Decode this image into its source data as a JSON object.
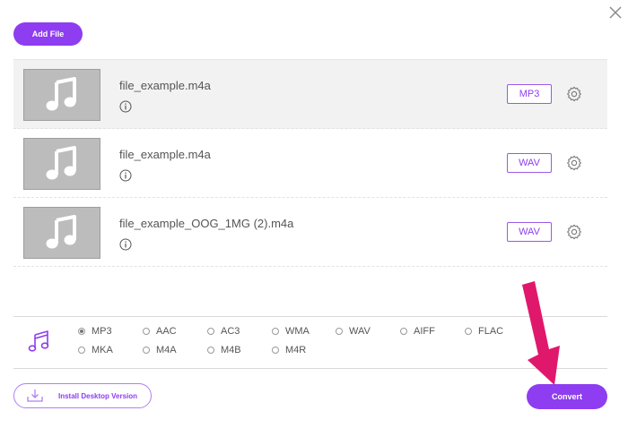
{
  "header": {
    "add_file_label": "Add File",
    "close_icon": "close-x-icon"
  },
  "files": [
    {
      "name": "file_example.m4a",
      "format": "MP3",
      "selected": true
    },
    {
      "name": "file_example.m4a",
      "format": "WAV",
      "selected": false
    },
    {
      "name": "file_example_OOG_1MG (2).m4a",
      "format": "WAV",
      "selected": false
    }
  ],
  "format_panel": {
    "icon": "music-note-icon",
    "options": [
      {
        "label": "MP3",
        "checked": true
      },
      {
        "label": "AAC",
        "checked": false
      },
      {
        "label": "AC3",
        "checked": false
      },
      {
        "label": "WMA",
        "checked": false
      },
      {
        "label": "WAV",
        "checked": false
      },
      {
        "label": "AIFF",
        "checked": false
      },
      {
        "label": "FLAC",
        "checked": false
      },
      {
        "label": "MKA",
        "checked": false
      },
      {
        "label": "M4A",
        "checked": false
      },
      {
        "label": "M4B",
        "checked": false
      },
      {
        "label": "M4R",
        "checked": false
      }
    ]
  },
  "footer": {
    "install_label": "Install Desktop Version",
    "convert_label": "Convert"
  },
  "colors": {
    "accent": "#8e3df0",
    "annotation_arrow": "#e0186c"
  }
}
